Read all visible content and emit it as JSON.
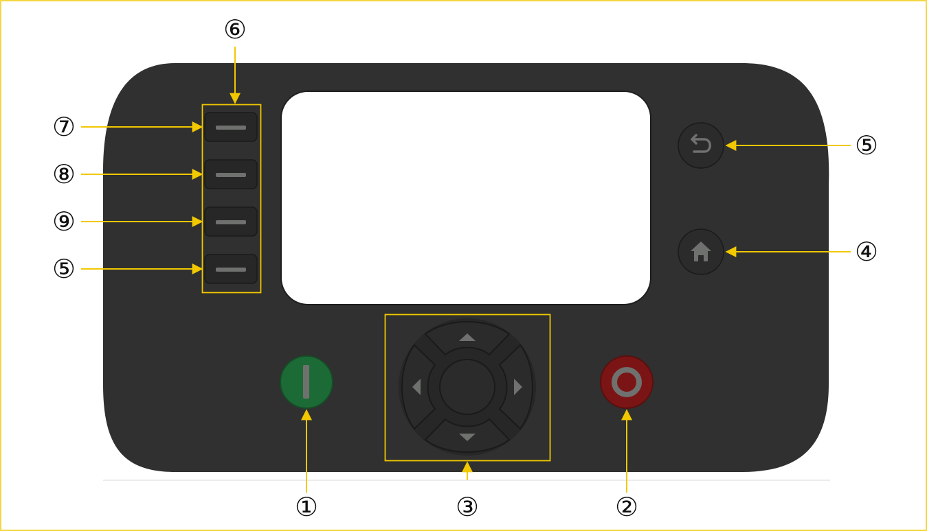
{
  "callouts": {
    "top_left_group": "⑥",
    "softkey_1": "⑦",
    "softkey_2": "⑧",
    "softkey_3": "⑨",
    "softkey_4": "⑤",
    "back_button": "⑤",
    "home_button": "④",
    "start_button": "①",
    "nav_pad": "③",
    "stop_button": "②"
  },
  "icons": {
    "back": "undo-arrow-icon",
    "home": "house-icon",
    "start": "vertical-bar-icon",
    "stop": "ring-icon",
    "nav_up": "triangle-up-icon",
    "nav_down": "triangle-down-icon",
    "nav_left": "triangle-left-icon",
    "nav_right": "triangle-right-icon",
    "softkey": "dash-icon"
  },
  "colors": {
    "panel": "#2f302f",
    "button": "#262726",
    "button_edge": "#1a1a1a",
    "screen": "#ffffff",
    "start": "#1c6b36",
    "stop": "#7b1515",
    "glyph": "#6f716f",
    "highlight": "#f2c800",
    "frame": "#f2c800"
  }
}
